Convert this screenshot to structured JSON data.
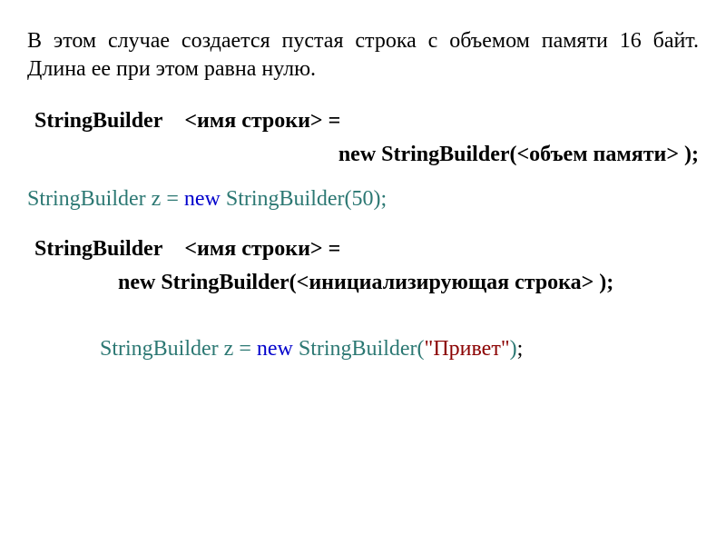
{
  "intro": "В этом случае создается пустая строка с объемом памяти 16 байт. Длина ее при этом равна нулю.",
  "syntax1": {
    "line1_part1": "StringBuilder",
    "line1_part2": "<имя строки> =",
    "line2": "new StringBuilder(<объем памяти> );"
  },
  "example1": {
    "p1": "StringBuilder z = ",
    "p2": "new ",
    "p3": "StringBuilder",
    "p4": "(",
    "p5": "50",
    "p6": ")",
    "p7": ";"
  },
  "syntax2": {
    "line1_part1": "StringBuilder",
    "line1_part2": "<имя строки> =",
    "line2": "new StringBuilder(<инициализирующая строка> );"
  },
  "example2": {
    "p1": "StringBuilder z = ",
    "p2": "new ",
    "p3": "StringBuilder",
    "p4": "(",
    "p5": "\"Привет\"",
    "p6": ")",
    "p7": ";"
  }
}
